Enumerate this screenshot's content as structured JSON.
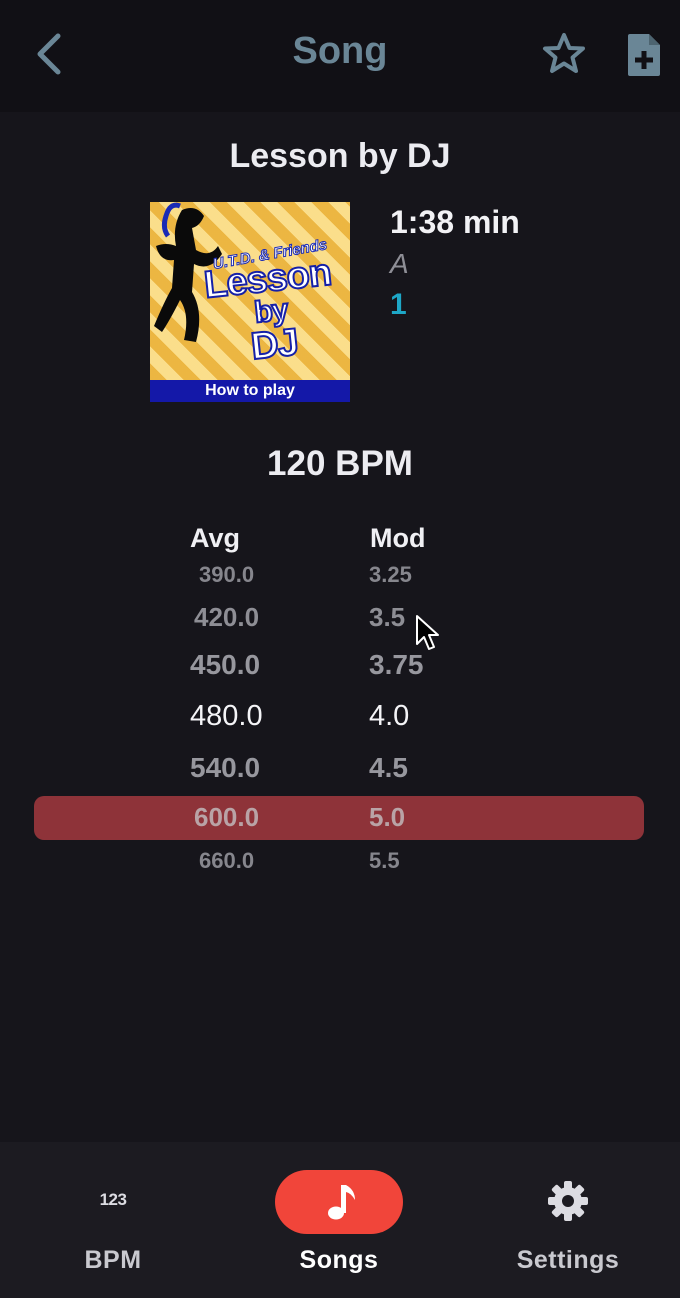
{
  "header": {
    "title": "Song",
    "back_icon": "chevron-left-icon",
    "favorite_icon": "star-outline-icon",
    "add_icon": "file-plus-icon"
  },
  "song": {
    "title": "Lesson by DJ",
    "duration": "1:38 min",
    "artist_initial": "A",
    "level": "1",
    "bpm": "120 BPM",
    "cover": {
      "brand": "U.T.D. & Friends",
      "title_line1": "Lesson",
      "title_line2": "by",
      "title_line3": "DJ",
      "banner": "How to play"
    }
  },
  "speed_table": {
    "avg_header": "Avg",
    "mod_header": "Mod",
    "rows": [
      {
        "avg": "390.0",
        "mod": "3.25"
      },
      {
        "avg": "420.0",
        "mod": "3.5"
      },
      {
        "avg": "450.0",
        "mod": "3.75"
      },
      {
        "avg": "480.0",
        "mod": "4.0"
      },
      {
        "avg": "540.0",
        "mod": "4.5"
      },
      {
        "avg": "600.0",
        "mod": "5.0"
      },
      {
        "avg": "660.0",
        "mod": "5.5"
      }
    ],
    "centered_row": 3,
    "highlighted_row": 5
  },
  "bottom_nav": {
    "items": [
      {
        "label": "BPM",
        "icon": "123-icon",
        "icon_text": "123"
      },
      {
        "label": "Songs",
        "icon": "music-note-icon",
        "active": true
      },
      {
        "label": "Settings",
        "icon": "gear-icon"
      }
    ]
  },
  "colors": {
    "background": "#16151b",
    "header_title": "#6a8696",
    "level": "#1ea7c7",
    "highlight_row": "#8e3339",
    "nav_active_pill": "#f1453a"
  }
}
